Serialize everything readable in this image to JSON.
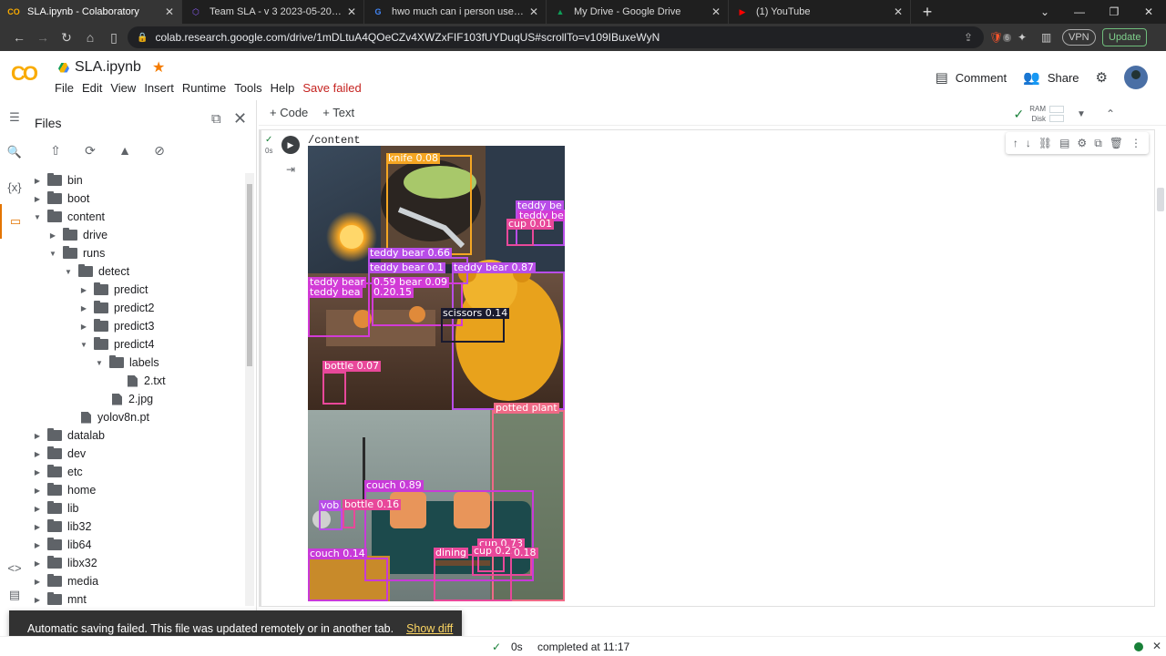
{
  "browser": {
    "tabs": [
      {
        "label": "SLA.ipynb - Colaboratory",
        "fav": "CO",
        "favcolor": "#f9ab00",
        "active": true
      },
      {
        "label": "Team SLA - v 3 2023-05-20 4:21am >",
        "fav": "⬡",
        "favcolor": "#8b5cf6",
        "active": false
      },
      {
        "label": "hwo much can i person use in google",
        "fav": "G",
        "favcolor": "#4285f4",
        "active": false
      },
      {
        "label": "My Drive - Google Drive",
        "fav": "▲",
        "favcolor": "#0f9d58",
        "active": false
      },
      {
        "label": "(1) YouTube",
        "fav": "▶",
        "favcolor": "#ff0000",
        "active": false
      }
    ],
    "url": "colab.research.google.com/drive/1mDLtuA4QOeCZv4XWZxFIF103fUYDuqUS#scrollTo=v109IBuxeWyN",
    "vpn_label": "VPN",
    "update_label": "Update",
    "ext_badge": "6"
  },
  "header": {
    "notebook_title": "SLA.ipynb",
    "menu": [
      "File",
      "Edit",
      "View",
      "Insert",
      "Runtime",
      "Tools",
      "Help"
    ],
    "save_status": "Save failed",
    "comment_label": "Comment",
    "share_label": "Share"
  },
  "files_panel": {
    "title": "Files",
    "tree": [
      {
        "label": "bin",
        "type": "folder",
        "depth": 0,
        "expanded": false
      },
      {
        "label": "boot",
        "type": "folder",
        "depth": 0,
        "expanded": false
      },
      {
        "label": "content",
        "type": "folder",
        "depth": 0,
        "expanded": true
      },
      {
        "label": "drive",
        "type": "folder",
        "depth": 1,
        "expanded": false
      },
      {
        "label": "runs",
        "type": "folder",
        "depth": 1,
        "expanded": true
      },
      {
        "label": "detect",
        "type": "folder",
        "depth": 2,
        "expanded": true
      },
      {
        "label": "predict",
        "type": "folder",
        "depth": 3,
        "expanded": false
      },
      {
        "label": "predict2",
        "type": "folder",
        "depth": 3,
        "expanded": false
      },
      {
        "label": "predict3",
        "type": "folder",
        "depth": 3,
        "expanded": false
      },
      {
        "label": "predict4",
        "type": "folder",
        "depth": 3,
        "expanded": true
      },
      {
        "label": "labels",
        "type": "folder",
        "depth": 4,
        "expanded": true
      },
      {
        "label": "2.txt",
        "type": "file",
        "depth": 5
      },
      {
        "label": "2.jpg",
        "type": "file",
        "depth": 4
      },
      {
        "label": "yolov8n.pt",
        "type": "file",
        "depth": 2
      },
      {
        "label": "datalab",
        "type": "folder",
        "depth": 0,
        "expanded": false
      },
      {
        "label": "dev",
        "type": "folder",
        "depth": 0,
        "expanded": false
      },
      {
        "label": "etc",
        "type": "folder",
        "depth": 0,
        "expanded": false
      },
      {
        "label": "home",
        "type": "folder",
        "depth": 0,
        "expanded": false
      },
      {
        "label": "lib",
        "type": "folder",
        "depth": 0,
        "expanded": false
      },
      {
        "label": "lib32",
        "type": "folder",
        "depth": 0,
        "expanded": false
      },
      {
        "label": "lib64",
        "type": "folder",
        "depth": 0,
        "expanded": false
      },
      {
        "label": "libx32",
        "type": "folder",
        "depth": 0,
        "expanded": false
      },
      {
        "label": "media",
        "type": "folder",
        "depth": 0,
        "expanded": false
      },
      {
        "label": "mnt",
        "type": "folder",
        "depth": 0,
        "expanded": false
      }
    ]
  },
  "notebook": {
    "add_code_label": "+ Code",
    "add_text_label": "+ Text",
    "ram_label": "RAM",
    "disk_label": "Disk",
    "cell_exec_time": "0s",
    "output_text": "/content"
  },
  "detections": [
    {
      "label": "knife 0.08",
      "color": "#f5a623"
    },
    {
      "label": "teddy bear 0.66",
      "color": "#b84de8"
    },
    {
      "label": "teddy bear 0.87",
      "color": "#b84de8"
    },
    {
      "label": "teddy bear 0.1",
      "color": "#b84de8"
    },
    {
      "label": "teddy bear",
      "color": "#d23bd6"
    },
    {
      "label": "teddy bea",
      "color": "#d23bd6"
    },
    {
      "label": "0.59 bear 0.09",
      "color": "#d23bd6"
    },
    {
      "label": "0.20.15",
      "color": "#d23bd6"
    },
    {
      "label": "teddy be",
      "color": "#d23bd6"
    },
    {
      "label": "teddy be",
      "color": "#d23bd6"
    },
    {
      "label": "cup 0.01",
      "color": "#e8489a"
    },
    {
      "label": "scissors 0.14",
      "color": "#1a1a2e"
    },
    {
      "label": "bottle 0.07",
      "color": "#e8489a"
    },
    {
      "label": "potted plant",
      "color": "#ef6a86"
    },
    {
      "label": "couch 0.89",
      "color": "#c83ad8"
    },
    {
      "label": "vob",
      "color": "#b84de8"
    },
    {
      "label": "bottle 0.16",
      "color": "#e8489a"
    },
    {
      "label": "couch 0.14",
      "color": "#c83ad8"
    },
    {
      "label": "cup 0.73",
      "color": "#e8489a"
    },
    {
      "label": "dining",
      "color": "#e8489a"
    },
    {
      "label": "cup 0.23",
      "color": "#e8489a"
    },
    {
      "label": "0.18",
      "color": "#e8489a"
    }
  ],
  "snackbar": {
    "message": "Automatic saving failed. This file was updated remotely or in another tab.",
    "action": "Show diff"
  },
  "statusbar": {
    "duration": "0s",
    "completed": "completed at 11:17"
  }
}
